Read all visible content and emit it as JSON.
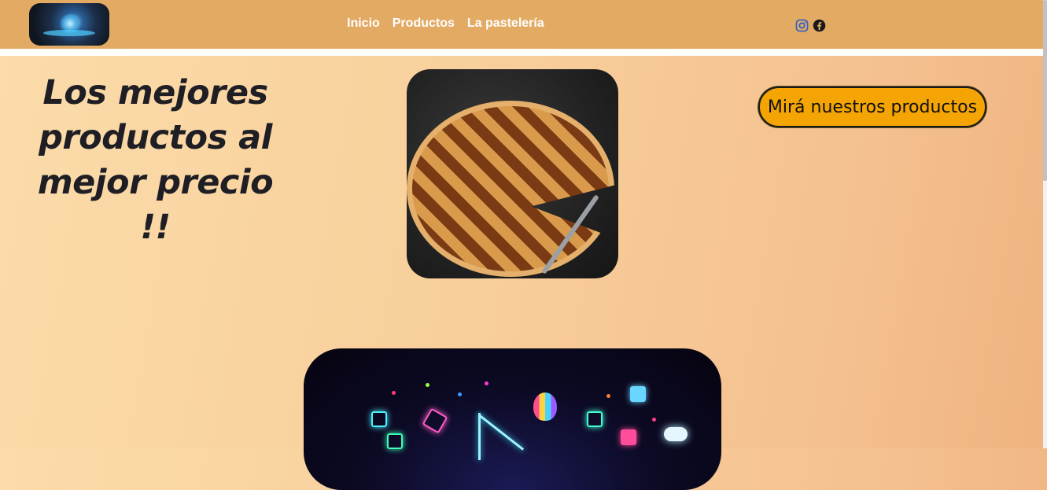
{
  "nav": {
    "logo_alt": "logo",
    "links": [
      "Inicio",
      "Productos",
      "La pastelería"
    ],
    "social_icons": [
      "instagram-icon",
      "facebook-icon"
    ]
  },
  "hero": {
    "title": "Los mejores productos al mejor precio !!",
    "image": "pie-image",
    "cta_label": "Mirá nuestros productos"
  },
  "bottom": {
    "image": "neon-digital-illustration"
  },
  "colors": {
    "navbar": "#e3aa64",
    "cta_background": "#f5a503",
    "title_text": "#1e1e24"
  }
}
